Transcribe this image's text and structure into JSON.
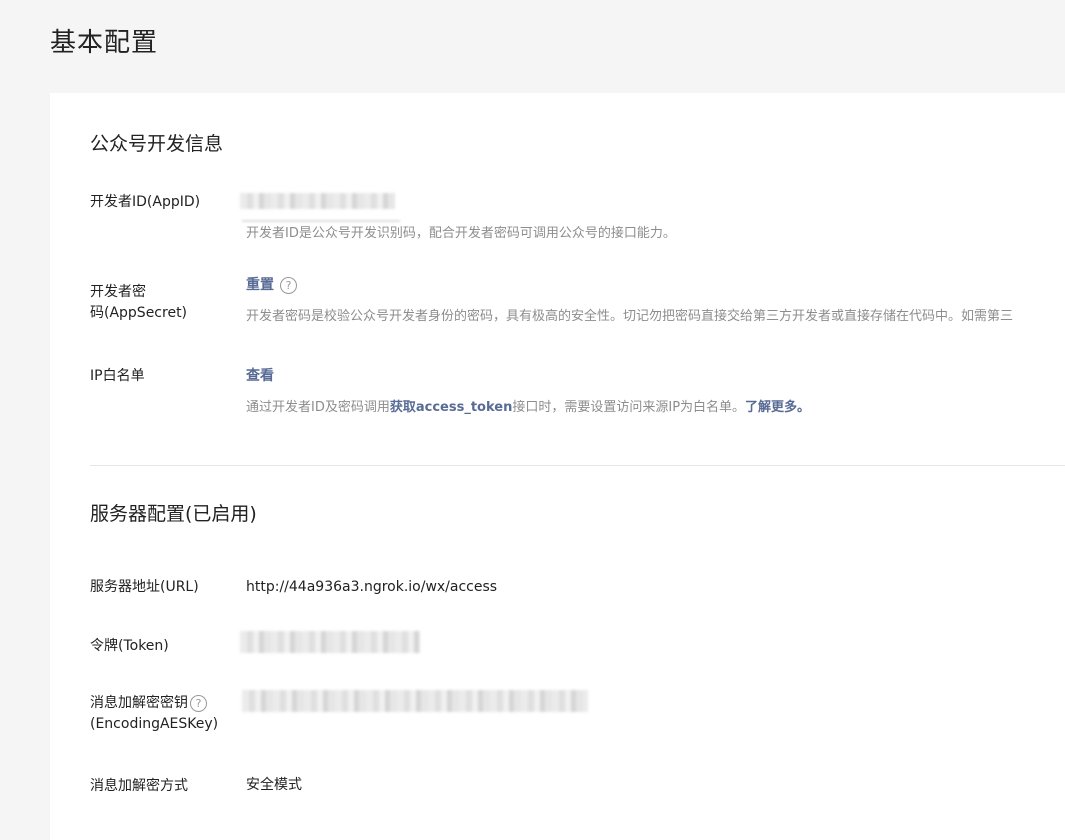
{
  "page": {
    "title": "基本配置"
  },
  "developer_info": {
    "section_title": "公众号开发信息",
    "appid": {
      "label": "开发者ID(AppID)",
      "desc": "开发者ID是公众号开发识别码，配合开发者密码可调用公众号的接口能力。"
    },
    "appsecret": {
      "label_line1": "开发者密",
      "label_line2": "码(AppSecret)",
      "reset_label": "重置",
      "help_glyph": "?",
      "desc": "开发者密码是校验公众号开发者身份的密码，具有极高的安全性。切记勿把密码直接交给第三方开发者或直接存储在代码中。如需第三"
    },
    "ip_whitelist": {
      "label": "IP白名单",
      "view_label": "查看",
      "desc_prefix": "通过开发者ID及密码调用",
      "desc_link": "获取access_token",
      "desc_middle": "接口时，需要设置访问来源IP为白名单。",
      "learn_more": "了解更多。"
    }
  },
  "server_config": {
    "section_title": "服务器配置(已启用)",
    "url": {
      "label": "服务器地址(URL)",
      "value": "http://44a936a3.ngrok.io/wx/access"
    },
    "token": {
      "label": "令牌(Token)"
    },
    "aes_key": {
      "label_line1": "消息加解密密钥",
      "help_glyph": "?",
      "label_line2": "(EncodingAESKey)"
    },
    "encrypt_mode": {
      "label": "消息加解密方式",
      "value": "安全模式"
    }
  },
  "icons": {
    "help": "help-circle-icon"
  },
  "colors": {
    "link": "#576b95",
    "desc": "#8d8d8d",
    "background": "#f5f5f5"
  }
}
